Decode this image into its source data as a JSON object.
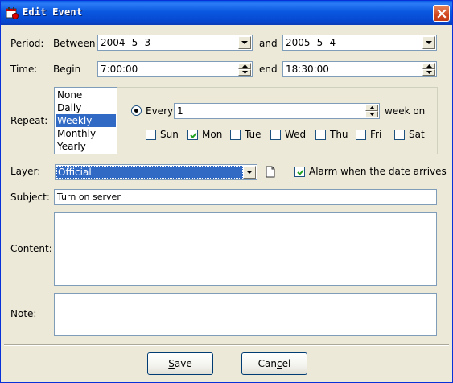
{
  "window": {
    "title": "Edit Event",
    "icon": "calendar-app-icon",
    "close_icon": "close-icon"
  },
  "period": {
    "label": "Period:",
    "between_label": "Between",
    "start_date": "2004- 5- 3",
    "and_label": "and",
    "end_date": "2005- 5- 4"
  },
  "time": {
    "label": "Time:",
    "begin_label": "Begin",
    "begin_value": "7:00:00",
    "end_label": "end",
    "end_value": "18:30:00"
  },
  "repeat": {
    "label": "Repeat:",
    "options": [
      "None",
      "Daily",
      "Weekly",
      "Monthly",
      "Yearly"
    ],
    "selected": "Weekly",
    "every_label": "Every",
    "every_value": "1",
    "week_on_label": "week on",
    "days": [
      {
        "label": "Sun",
        "checked": false
      },
      {
        "label": "Mon",
        "checked": true
      },
      {
        "label": "Tue",
        "checked": false
      },
      {
        "label": "Wed",
        "checked": false
      },
      {
        "label": "Thu",
        "checked": false
      },
      {
        "label": "Fri",
        "checked": false
      },
      {
        "label": "Sat",
        "checked": false
      }
    ]
  },
  "layer": {
    "label": "Layer:",
    "value": "Official",
    "alarm_label": "Alarm when the date arrives",
    "alarm_checked": true
  },
  "subject": {
    "label": "Subject:",
    "value": "Turn on server"
  },
  "content": {
    "label": "Content:",
    "value": ""
  },
  "note": {
    "label": "Note:",
    "value": ""
  },
  "buttons": {
    "save": {
      "prefix": "",
      "accel": "S",
      "suffix": "ave"
    },
    "cancel": {
      "prefix": "Can",
      "accel": "c",
      "suffix": "el"
    }
  },
  "colors": {
    "titlebar": "#0A58E0",
    "selection": "#316AC5",
    "dialog_bg": "#ECE9D8",
    "field_border": "#7F9DB9"
  }
}
